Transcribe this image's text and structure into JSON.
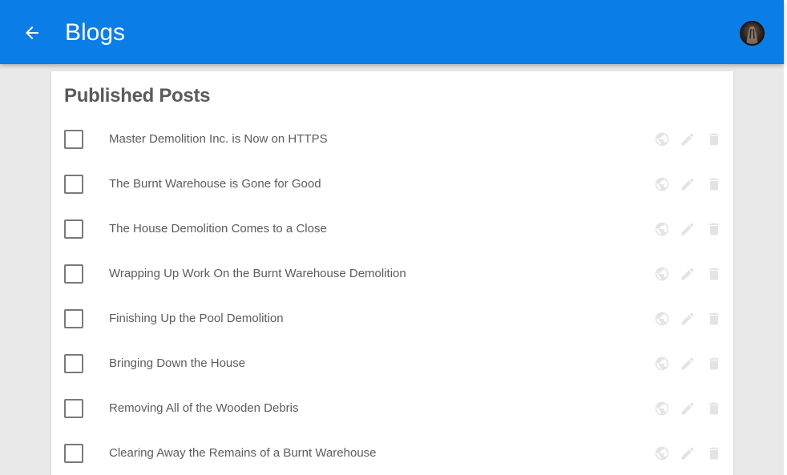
{
  "app_bar": {
    "title": "Blogs",
    "back_icon": "arrow-left-icon",
    "background_color": "#0a7de6",
    "avatar_icon": "user-avatar"
  },
  "published_posts": {
    "heading": "Published Posts",
    "row_action_icons": [
      "globe-icon",
      "pencil-icon",
      "trash-icon"
    ],
    "posts": [
      {
        "title": "Master Demolition Inc. is Now on HTTPS",
        "checked": false
      },
      {
        "title": "The Burnt Warehouse is Gone for Good",
        "checked": false
      },
      {
        "title": "The House Demolition Comes to a Close",
        "checked": false
      },
      {
        "title": "Wrapping Up Work On the Burnt Warehouse Demolition",
        "checked": false
      },
      {
        "title": "Finishing Up the Pool Demolition",
        "checked": false
      },
      {
        "title": "Bringing Down the House",
        "checked": false
      },
      {
        "title": "Removing All of the Wooden Debris",
        "checked": false
      },
      {
        "title": "Clearing Away the Remains of a Burnt Warehouse",
        "checked": false
      }
    ]
  }
}
